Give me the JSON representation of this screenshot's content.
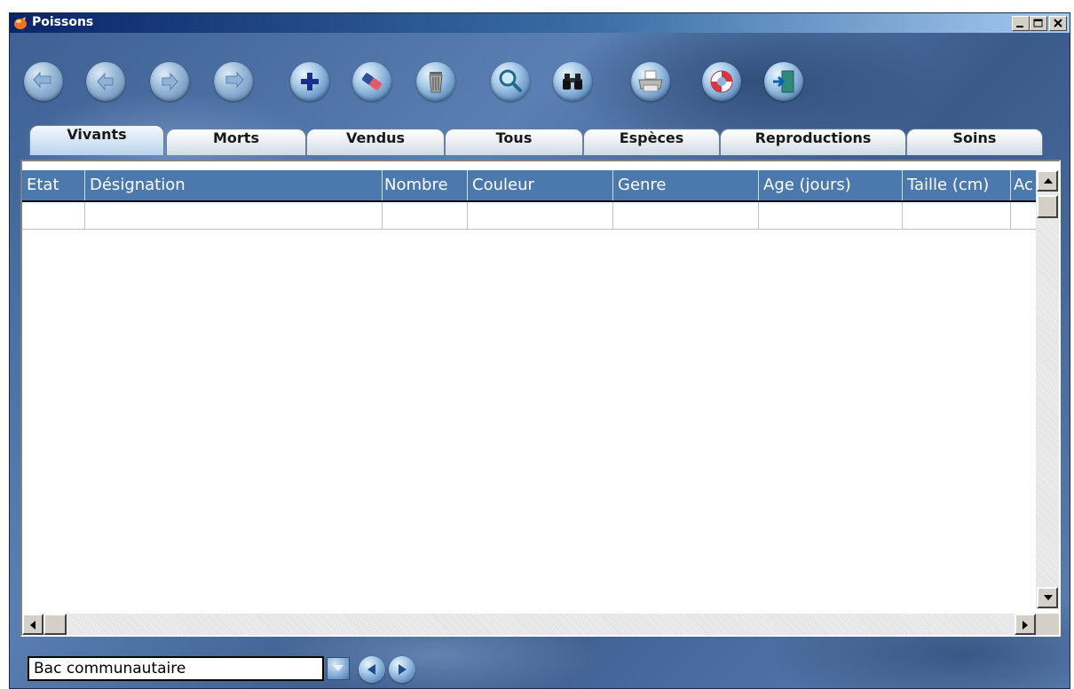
{
  "window": {
    "title": "Poissons",
    "title_bar_buttons": [
      "minimize-icon",
      "maximize-icon",
      "close-icon"
    ]
  },
  "toolbar": {
    "buttons": [
      {
        "icon": "first-record-icon"
      },
      {
        "icon": "previous-record-icon"
      },
      {
        "icon": "next-record-icon"
      },
      {
        "icon": "last-record-icon"
      },
      {
        "icon": "add-icon"
      },
      {
        "icon": "eraser-icon"
      },
      {
        "icon": "trash-icon"
      },
      {
        "icon": "search-icon"
      },
      {
        "icon": "binoculars-icon"
      },
      {
        "icon": "printer-icon"
      },
      {
        "icon": "lifebuoy-icon"
      },
      {
        "icon": "exit-door-icon"
      }
    ]
  },
  "tabs": [
    {
      "label": "Vivants",
      "active": true
    },
    {
      "label": "Morts"
    },
    {
      "label": "Vendus"
    },
    {
      "label": "Tous"
    },
    {
      "label": "Espèces"
    },
    {
      "label": "Reproductions"
    },
    {
      "label": "Soins"
    }
  ],
  "grid": {
    "columns": [
      "Etat",
      "Désignation",
      "Nombre",
      "Couleur",
      "Genre",
      "Age (jours)",
      "Taille (cm)",
      "Ac"
    ],
    "rows": [
      [
        "",
        "",
        "",
        "",
        "",
        "",
        "",
        ""
      ]
    ]
  },
  "footer": {
    "tank_select": "Bac communautaire"
  },
  "colors": {
    "titlebar_start": "#0a246a",
    "titlebar_end": "#a6caf0",
    "grid_header": "#4b79ad",
    "background": "#44679a"
  }
}
